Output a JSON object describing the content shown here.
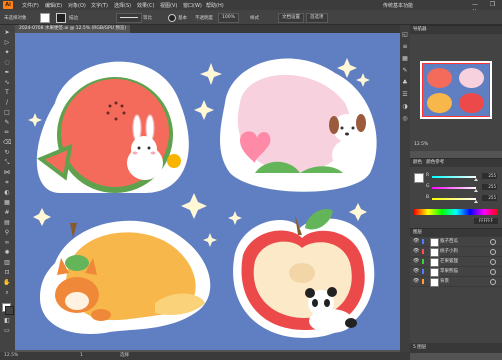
{
  "app": {
    "logo": "Ai"
  },
  "menubar": {
    "items": [
      "文件(F)",
      "编辑(E)",
      "对象(O)",
      "文字(T)",
      "选择(S)",
      "效果(C)",
      "视图(V)",
      "窗口(W)",
      "帮助(H)"
    ],
    "workspace": "传统基本功能",
    "window_controls": "— ❐ ✕"
  },
  "control_bar": {
    "selection_label": "未选择对象",
    "stroke_label": "描边",
    "stroke_style": "等比",
    "brush_label": "基本",
    "opacity_label": "不透明度",
    "opacity_value": "100%",
    "style_label": "样式",
    "doc_setup": "文档设置",
    "prefs": "首选项"
  },
  "document": {
    "tab_title": "2024-0708 水果便签.ai @ 12.5% (RGB/GPU 预览)"
  },
  "status": {
    "zoom": "12.5%",
    "page": "1",
    "tool": "选择"
  },
  "navigator": {
    "title": "导航器",
    "zoom": "12.5%"
  },
  "color_panel": {
    "title": "颜色",
    "tabs": [
      "颜色",
      "颜色参考"
    ],
    "channels": [
      {
        "name": "R",
        "value": "255",
        "fill": 1.0,
        "gradient": "linear-gradient(90deg,#00ffff,#ffffff)"
      },
      {
        "name": "G",
        "value": "255",
        "fill": 1.0,
        "gradient": "linear-gradient(90deg,#ff00ff,#ffffff)"
      },
      {
        "name": "B",
        "value": "255",
        "fill": 1.0,
        "gradient": "linear-gradient(90deg,#ffff00,#ffffff)"
      }
    ],
    "hex": "FFFFFF"
  },
  "layers_panel": {
    "title": "图层",
    "layers": [
      {
        "name": "猴子西瓜",
        "color": "#4f7dff",
        "visible": true
      },
      {
        "name": "桃子小狗",
        "color": "#ff4f4f",
        "visible": true
      },
      {
        "name": "芒果狐狸",
        "color": "#3bd33b",
        "visible": true
      },
      {
        "name": "苹果熊猫",
        "color": "#4f7dff",
        "visible": true
      },
      {
        "name": "背景",
        "color": "#ff9f3b",
        "visible": true
      }
    ],
    "footer": "5 图层"
  },
  "colors": {
    "artboard_bg": "#5f7fc2",
    "accent": "#ff7f18"
  }
}
